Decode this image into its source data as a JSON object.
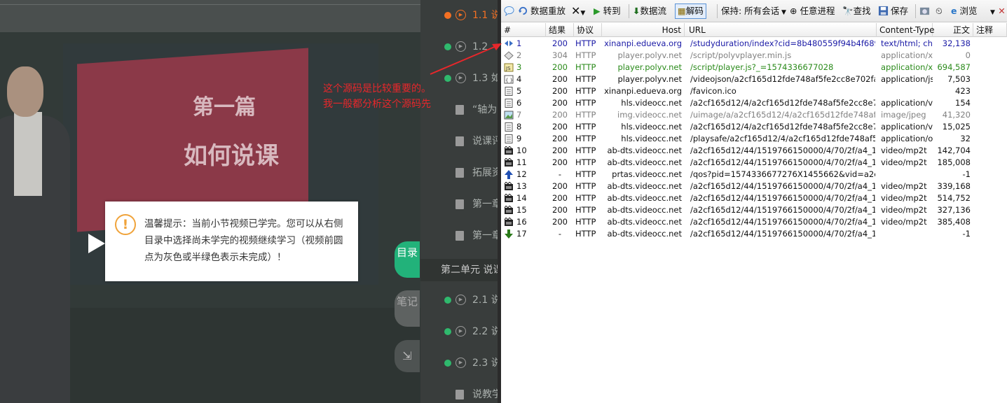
{
  "notice": {
    "icon": "!",
    "text": "温馨提示：当前小节视频已学完。您可以从右侧目录中选择尚未学完的视频继续学习（视频前圆点为灰色或半绿色表示未完成）！"
  },
  "slide": {
    "line1": "第一篇",
    "line2": "如何说课"
  },
  "side_tabs": {
    "catalog": "目录",
    "notes": "笔记",
    "expand_icon": "⇲"
  },
  "catalog": {
    "items": [
      {
        "label": "1.1 说",
        "type": "video",
        "status": "current"
      },
      {
        "label": "1.2 ",
        "type": "video",
        "status": "done"
      },
      {
        "label": "1.3 如",
        "type": "video",
        "status": "done"
      },
      {
        "label": "“轴为",
        "type": "doc"
      },
      {
        "label": "说课评",
        "type": "doc"
      },
      {
        "label": "拓展资",
        "type": "doc"
      },
      {
        "label": "第一章",
        "type": "doc"
      },
      {
        "label": "第一章",
        "type": "doc"
      },
      {
        "label": "第二单元 说课",
        "type": "section"
      },
      {
        "label": "2.1 说",
        "type": "video",
        "status": "done"
      },
      {
        "label": "2.2 说",
        "type": "video",
        "status": "done"
      },
      {
        "label": "2.3 说",
        "type": "video",
        "status": "done"
      },
      {
        "label": "说教学",
        "type": "doc"
      }
    ]
  },
  "toolbar": {
    "replay": "数据重放",
    "goto": "转到",
    "stream": "数据流",
    "decode": "解码",
    "keep": "保持: 所有会话",
    "process": "任意进程",
    "find": "查找",
    "save": "保存",
    "browse": "浏览"
  },
  "columns": {
    "num": "#",
    "result": "结果",
    "protocol": "协议",
    "host": "Host",
    "url": "URL",
    "content_type": "Content-Type",
    "body": "正文",
    "comment": "注释"
  },
  "sessions": [
    {
      "num": "1",
      "result": "200",
      "protocol": "HTTP",
      "host": "xinanpi.edueva.org",
      "url": "/studyduration/index?cid=8b480559f94b4f689746...",
      "content_type": "text/html; ch...",
      "body": "32,138",
      "style": "blue",
      "icon": "arrows"
    },
    {
      "num": "2",
      "result": "304",
      "protocol": "HTTP",
      "host": "player.polyv.net",
      "url": "/script/polyvplayer.min.js",
      "content_type": "application/x...",
      "body": "0",
      "style": "gray",
      "icon": "diamond"
    },
    {
      "num": "3",
      "result": "200",
      "protocol": "HTTP",
      "host": "player.polyv.net",
      "url": "/script/player.js?_=1574336677028",
      "content_type": "application/x...",
      "body": "694,587",
      "style": "green",
      "icon": "js"
    },
    {
      "num": "4",
      "result": "200",
      "protocol": "HTTP",
      "host": "player.polyv.net",
      "url": "/videojson/a2cf165d12fde748af5fe2cc8e702fa4_a...",
      "content_type": "application/js...",
      "body": "7,503",
      "style": "normal",
      "icon": "json"
    },
    {
      "num": "5",
      "result": "200",
      "protocol": "HTTP",
      "host": "xinanpi.edueva.org",
      "url": "/favicon.ico",
      "content_type": "",
      "body": "423",
      "style": "normal",
      "icon": "page"
    },
    {
      "num": "6",
      "result": "200",
      "protocol": "HTTP",
      "host": "hls.videocc.net",
      "url": "/a2cf165d12/4/a2cf165d12fde748af5fe2cc8e702fa...",
      "content_type": "application/v...",
      "body": "154",
      "style": "normal",
      "icon": "page"
    },
    {
      "num": "7",
      "result": "200",
      "protocol": "HTTP",
      "host": "img.videocc.net",
      "url": "/uimage/a/a2cf165d12/4/a2cf165d12fde748af5fe2...",
      "content_type": "image/jpeg",
      "body": "41,320",
      "style": "gray",
      "icon": "image"
    },
    {
      "num": "8",
      "result": "200",
      "protocol": "HTTP",
      "host": "hls.videocc.net",
      "url": "/a2cf165d12/4/a2cf165d12fde748af5fe2cc8e702fa...",
      "content_type": "application/v...",
      "body": "15,025",
      "style": "normal",
      "icon": "page"
    },
    {
      "num": "9",
      "result": "200",
      "protocol": "HTTP",
      "host": "hls.videocc.net",
      "url": "/playsafe/a2cf165d12/4/a2cf165d12fde748af5fe2c...",
      "content_type": "application/o...",
      "body": "32",
      "style": "normal",
      "icon": "page"
    },
    {
      "num": "10",
      "result": "200",
      "protocol": "HTTP",
      "host": "ab-dts.videocc.net",
      "url": "/a2cf165d12/44/1519766150000/4/70/2f/a4_1/a2c...",
      "content_type": "video/mp2t",
      "body": "142,704",
      "style": "normal",
      "icon": "film"
    },
    {
      "num": "11",
      "result": "200",
      "protocol": "HTTP",
      "host": "ab-dts.videocc.net",
      "url": "/a2cf165d12/44/1519766150000/4/70/2f/a4_1/a2c...",
      "content_type": "video/mp2t",
      "body": "185,008",
      "style": "normal",
      "icon": "film"
    },
    {
      "num": "12",
      "result": "-",
      "protocol": "HTTP",
      "host": "prtas.videocc.net",
      "url": "/qos?pid=1574336677276X1455662&vid=a2cf165d...",
      "content_type": "",
      "body": "-1",
      "style": "normal",
      "icon": "up"
    },
    {
      "num": "13",
      "result": "200",
      "protocol": "HTTP",
      "host": "ab-dts.videocc.net",
      "url": "/a2cf165d12/44/1519766150000/4/70/2f/a4_1/a2c...",
      "content_type": "video/mp2t",
      "body": "339,168",
      "style": "normal",
      "icon": "film"
    },
    {
      "num": "14",
      "result": "200",
      "protocol": "HTTP",
      "host": "ab-dts.videocc.net",
      "url": "/a2cf165d12/44/1519766150000/4/70/2f/a4_1/a2c...",
      "content_type": "video/mp2t",
      "body": "514,752",
      "style": "normal",
      "icon": "film"
    },
    {
      "num": "15",
      "result": "200",
      "protocol": "HTTP",
      "host": "ab-dts.videocc.net",
      "url": "/a2cf165d12/44/1519766150000/4/70/2f/a4_1/a2c...",
      "content_type": "video/mp2t",
      "body": "327,136",
      "style": "normal",
      "icon": "film"
    },
    {
      "num": "16",
      "result": "200",
      "protocol": "HTTP",
      "host": "ab-dts.videocc.net",
      "url": "/a2cf165d12/44/1519766150000/4/70/2f/a4_1/a2c...",
      "content_type": "video/mp2t",
      "body": "385,408",
      "style": "normal",
      "icon": "film"
    },
    {
      "num": "17",
      "result": "-",
      "protocol": "HTTP",
      "host": "ab-dts.videocc.net",
      "url": "/a2cf165d12/44/1519766150000/4/70/2f/a4_1/a2c...",
      "content_type": "",
      "body": "-1",
      "style": "normal",
      "icon": "down"
    }
  ],
  "annotation": {
    "line1": "这个源码是比较重要的。",
    "line2": "我一般都分析这个源码先",
    "color": "#e8272b"
  }
}
